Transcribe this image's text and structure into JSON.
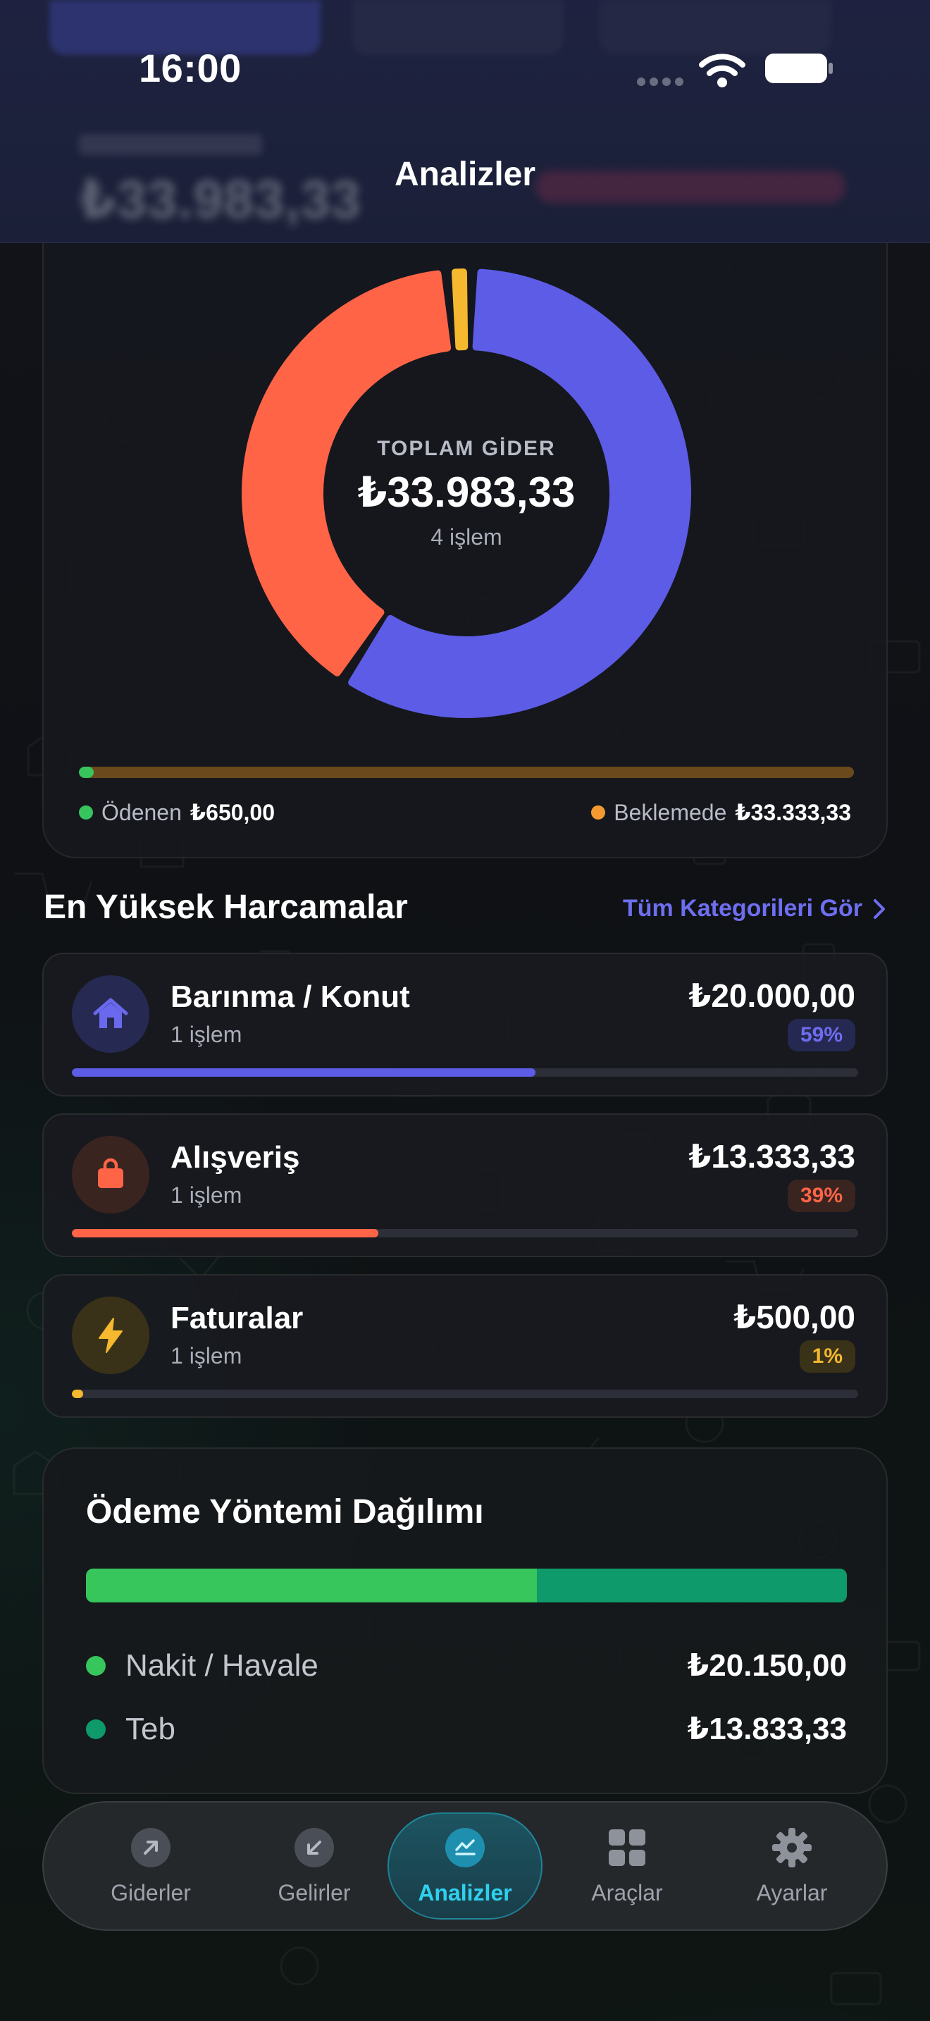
{
  "status_bar": {
    "time": "16:00"
  },
  "header": {
    "title": "Analizler",
    "background_amount": "₺33.983,33"
  },
  "summary": {
    "caption": "TOPLAM GİDER",
    "total": "₺33.983,33",
    "count": "4 işlem",
    "paid_label": "Ödenen",
    "paid_value": "₺650,00",
    "paid_fraction": 0.019,
    "pending_label": "Beklemede",
    "pending_value": "₺33.333,33",
    "colors": {
      "paid": "#37c45d",
      "pending": "#f39a30",
      "track": "#6a4a1c"
    }
  },
  "chart_data": {
    "type": "pie",
    "categories": [
      "Barınma / Konut",
      "Alışveriş",
      "Faturalar"
    ],
    "values": [
      20000.0,
      13333.33,
      500.0
    ],
    "colors": [
      "#5d5ce6",
      "#ff6447",
      "#f5b82e"
    ],
    "title": "",
    "xlabel": "",
    "ylabel": ""
  },
  "top_spending": {
    "title": "En Yüksek Harcamalar",
    "see_all": "Tüm Kategorileri Gör",
    "items": [
      {
        "name": "Barınma / Konut",
        "count": "1 işlem",
        "amount": "₺20.000,00",
        "percent_label": "59%",
        "percent": 0.59,
        "color": "#5d5ce6",
        "icon": "home-icon"
      },
      {
        "name": "Alışveriş",
        "count": "1 işlem",
        "amount": "₺13.333,33",
        "percent_label": "39%",
        "percent": 0.39,
        "color": "#ff6447",
        "icon": "shopping-bag-icon"
      },
      {
        "name": "Faturalar",
        "count": "1 işlem",
        "amount": "₺500,00",
        "percent_label": "1%",
        "percent": 0.01,
        "color": "#f5b82e",
        "icon": "lightning-icon"
      }
    ]
  },
  "payment_methods": {
    "title": "Ödeme Yöntemi Dağılımı",
    "items": [
      {
        "name": "Nakit / Havale",
        "amount": "₺20.150,00",
        "value": 20150.0,
        "color": "#36c65c"
      },
      {
        "name": "Teb",
        "amount": "₺13.833,33",
        "value": 13833.33,
        "color": "#0e9a6a"
      }
    ]
  },
  "tabbar": {
    "items": [
      {
        "label": "Giderler",
        "icon": "arrow-up-right-icon"
      },
      {
        "label": "Gelirler",
        "icon": "arrow-down-left-icon"
      },
      {
        "label": "Analizler",
        "icon": "chart-icon",
        "active": true
      },
      {
        "label": "Araçlar",
        "icon": "grid-icon"
      },
      {
        "label": "Ayarlar",
        "icon": "gear-icon"
      }
    ]
  }
}
